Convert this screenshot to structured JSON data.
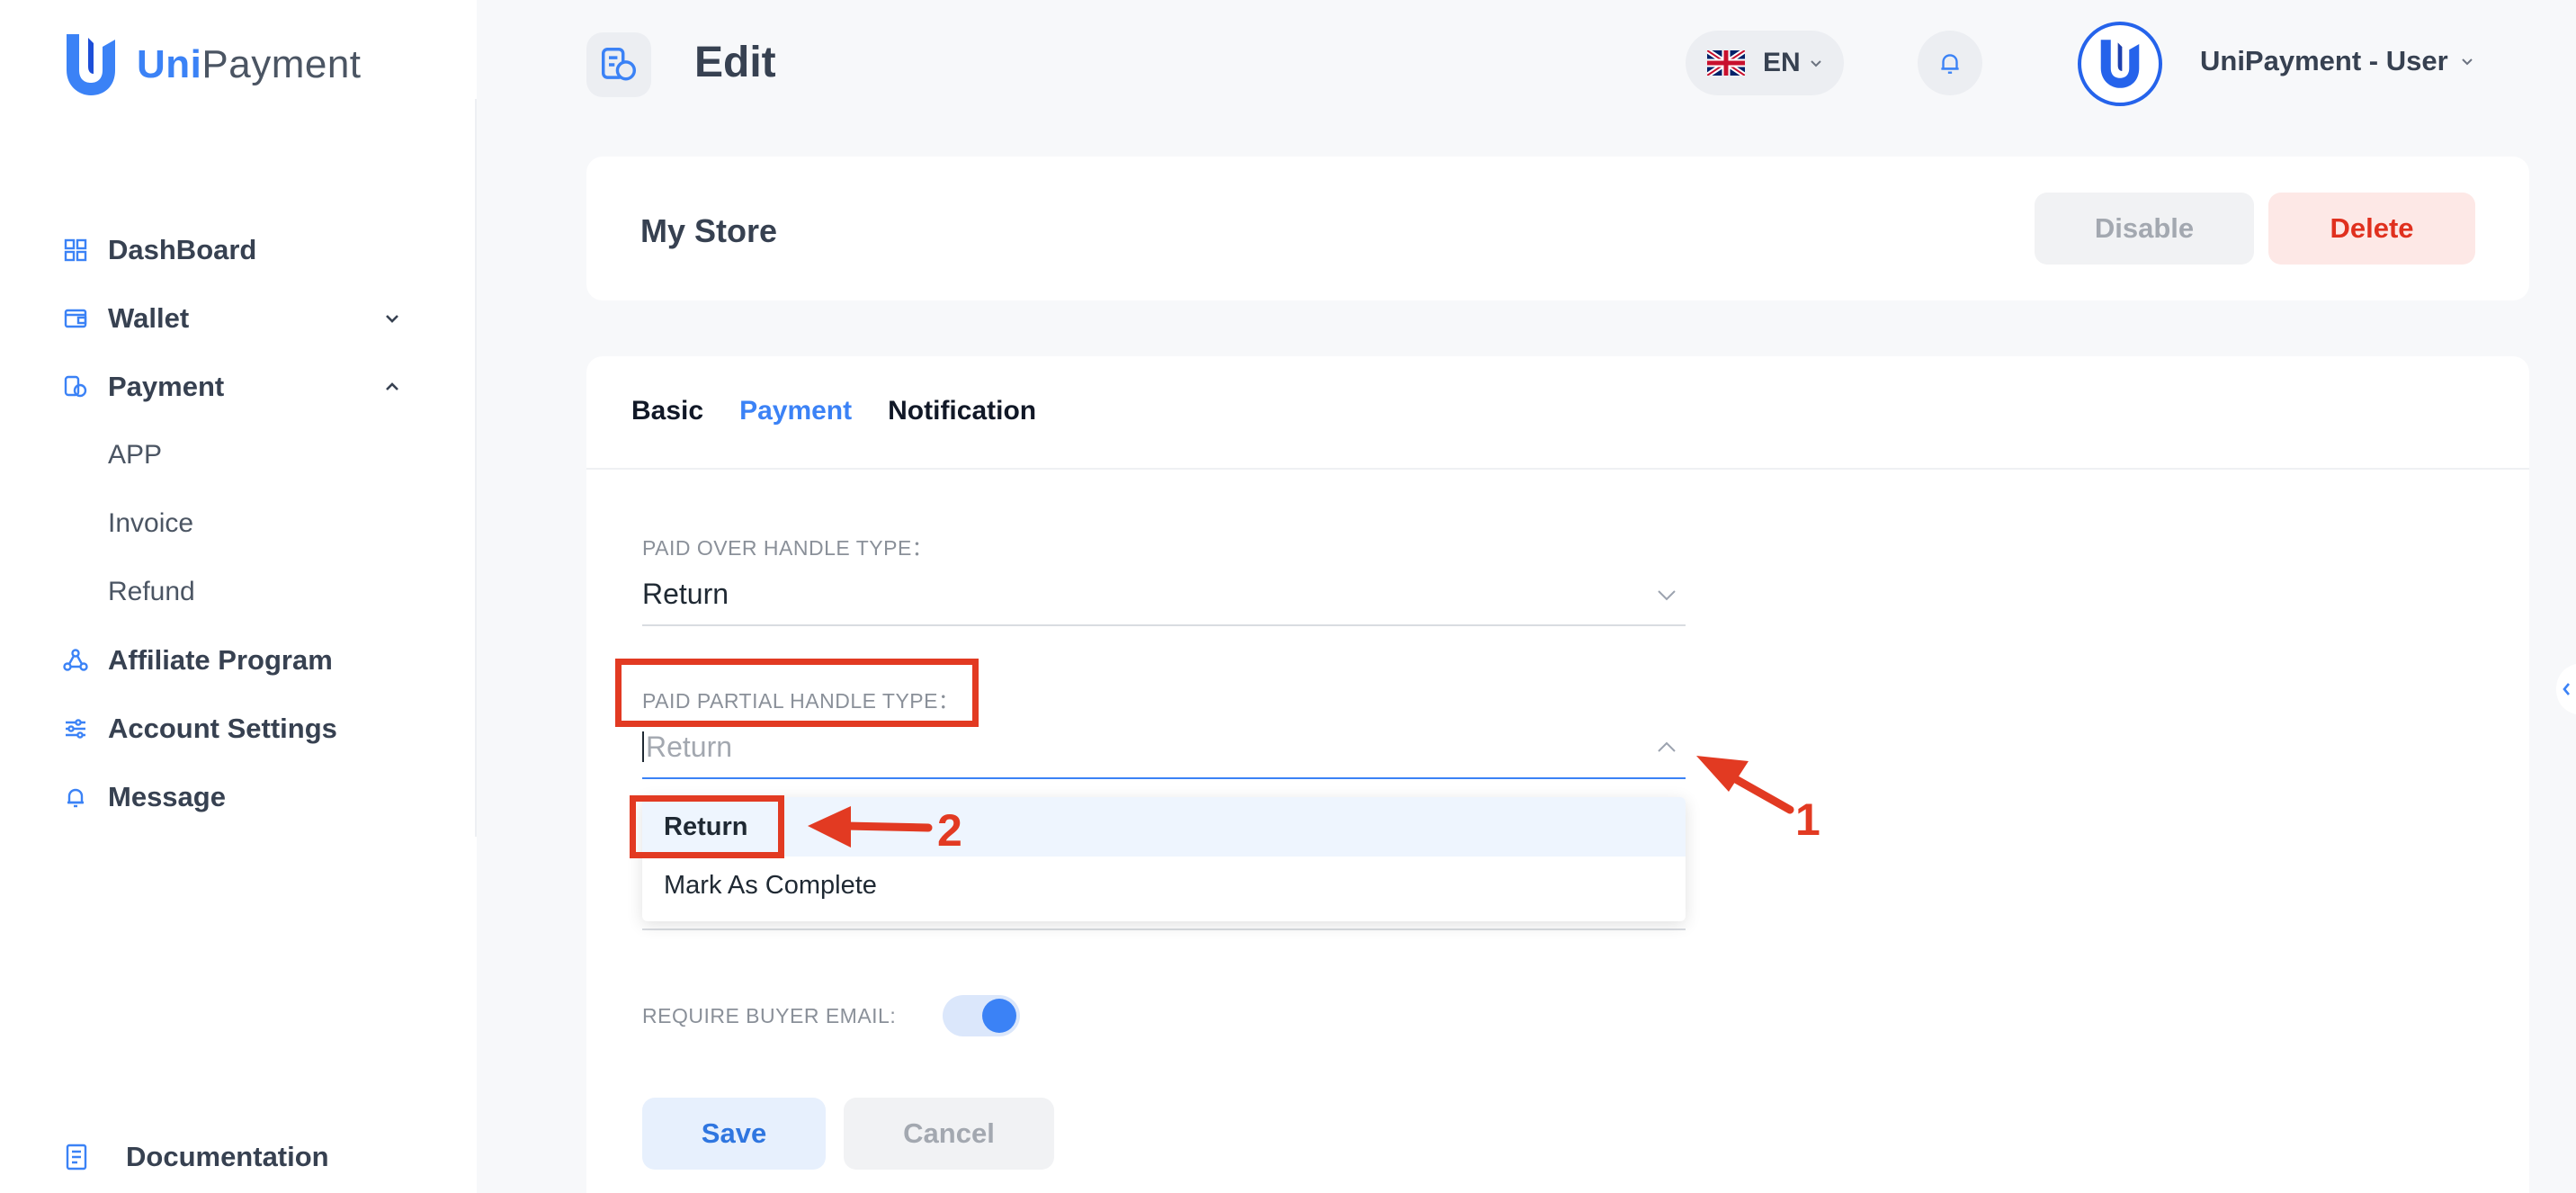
{
  "brand": {
    "name_part1": "Uni",
    "name_part2": "Payment"
  },
  "sidebar": {
    "items": [
      {
        "label": "DashBoard",
        "icon": "grid-icon"
      },
      {
        "label": "Wallet",
        "icon": "wallet-icon",
        "caret": "chevron-down-icon"
      },
      {
        "label": "Payment",
        "icon": "coins-icon",
        "caret": "chevron-up-icon"
      },
      {
        "label": "Affiliate Program",
        "icon": "network-icon"
      },
      {
        "label": "Account Settings",
        "icon": "sliders-icon"
      },
      {
        "label": "Message",
        "icon": "bell-icon"
      }
    ],
    "payment_sub": [
      "APP",
      "Invoice",
      "Refund"
    ],
    "documentation": "Documentation"
  },
  "header": {
    "title": "Edit",
    "language": "EN",
    "user": "UniPayment - User"
  },
  "store": {
    "title": "My Store",
    "disable_label": "Disable",
    "delete_label": "Delete"
  },
  "tabs": [
    {
      "label": "Basic",
      "active": false
    },
    {
      "label": "Payment",
      "active": true
    },
    {
      "label": "Notification",
      "active": false
    }
  ],
  "form": {
    "paid_over": {
      "label": "PAID OVER HANDLE TYPE：",
      "value": "Return"
    },
    "paid_partial": {
      "label": "PAID PARTIAL HANDLE TYPE：",
      "placeholder": "Return"
    },
    "options": [
      "Return",
      "Mark As Complete"
    ],
    "require_email": {
      "label": "REQUIRE BUYER EMAIL:",
      "enabled": true
    },
    "save_label": "Save",
    "cancel_label": "Cancel"
  },
  "annotations": {
    "step1": "1",
    "step2": "2"
  },
  "colors": {
    "accent": "#3b82f6",
    "danger": "#e0301e",
    "annotation": "#e23a22"
  }
}
